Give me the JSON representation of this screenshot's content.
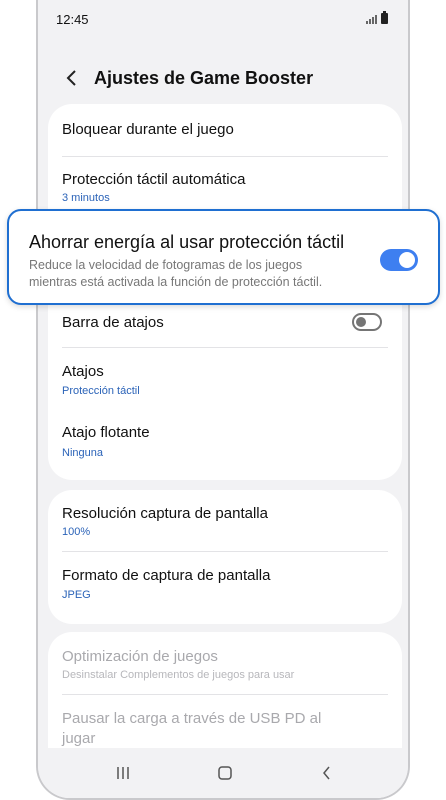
{
  "status": {
    "time": "12:45"
  },
  "header": {
    "title": "Ajustes de Game Booster"
  },
  "card1": {
    "items": [
      {
        "title": "Bloquear durante el juego"
      },
      {
        "title": "Protección táctil automática",
        "sub": "3 minutos"
      },
      {
        "title": "Barra de atajos",
        "toggle": "off"
      },
      {
        "title": "Atajos",
        "sub": "Protección táctil"
      },
      {
        "title": "Atajo flotante",
        "sub": "Ninguna"
      }
    ]
  },
  "card2": {
    "items": [
      {
        "title": "Resolución captura de pantalla",
        "sub": "100%"
      },
      {
        "title": "Formato de captura de pantalla",
        "sub": "JPEG"
      }
    ]
  },
  "card3": {
    "items": [
      {
        "title": "Optimización de juegos",
        "sub": "Desinstalar Complementos de juegos para usar"
      },
      {
        "title_line1": "Pausar la carga a través de USB PD al",
        "title_line2": "jugar"
      }
    ]
  },
  "highlight": {
    "title": "Ahorrar energía al usar protección táctil",
    "desc_line1": "Reduce la velocidad de fotogramas de los juegos",
    "desc_line2": "mientras está activada la función de protección táctil.",
    "toggle": "on"
  },
  "colors": {
    "accent": "#3e7ff0",
    "link": "#2b63b8",
    "highlight_border": "#1f6fd1"
  }
}
